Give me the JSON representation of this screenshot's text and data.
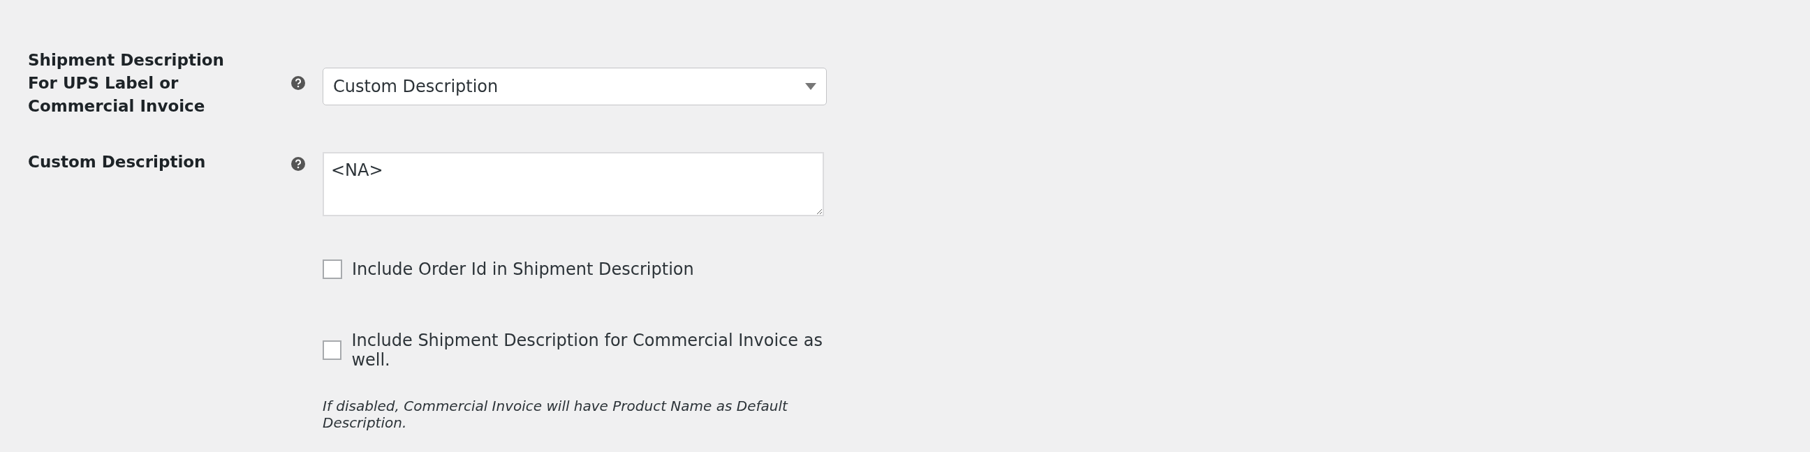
{
  "fields": [
    {
      "label": "Shipment Description For UPS Label or Commercial Invoice",
      "kind": "select",
      "value": "Custom Description"
    },
    {
      "label": "Custom Description",
      "kind": "textarea",
      "value": "<NA>",
      "options": [
        {
          "label": "Include Order Id in Shipment Description",
          "checked": false
        },
        {
          "label": "Include Shipment Description for Commercial Invoice as well.",
          "checked": false
        }
      ],
      "description": "If disabled, Commercial Invoice will have Product Name as Default Description."
    }
  ]
}
